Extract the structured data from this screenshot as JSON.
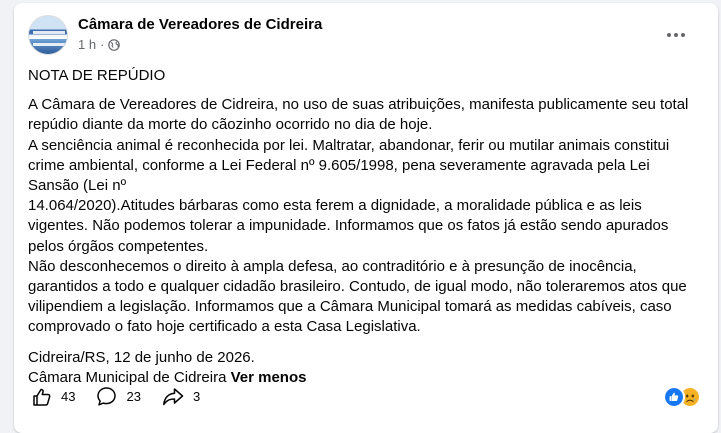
{
  "post": {
    "page_name": "Câmara de Vereadores de Cidreira",
    "time": "1 h",
    "separator": "·",
    "title": "NOTA DE REPÚDIO",
    "paragraph1": "A Câmara de Vereadores de Cidreira, no uso de suas atribuições, manifesta publicamente seu total repúdio diante da morte do cãozinho ocorrido no dia de hoje.\nA senciência animal é reconhecida por lei. Maltratar, abandonar, ferir ou mutilar animais constitui crime ambiental, conforme a Lei Federal nº 9.605/1998, pena severamente agravada pela Lei Sansão (Lei nº\n14.064/2020).Atitudes bárbaras como esta ferem a dignidade, a moralidade pública e as leis vigentes. Não podemos tolerar a impunidade. Informamos que os fatos já estão sendo apurados pelos órgãos competentes.\nNão desconhecemos o direito à ampla defesa, ao contraditório e à presunção de inocência, garantidos a todo e qualquer cidadão brasileiro. Contudo, de igual modo, não toleraremos atos que vilipendiem a legislação. Informamos que a Câmara Municipal tomará as medidas cabíveis, caso comprovado o fato hoje certificado a esta Casa Legislativa.",
    "date_line": "Cidreira/RS, 12 de junho de 2026.",
    "signature": "Câmara Municipal de Cidreira",
    "see_more": "Ver menos"
  },
  "actions": {
    "like_count": "43",
    "comment_count": "23",
    "share_count": "3"
  },
  "icons": {
    "more": "more-horizontal-icon",
    "audience": "globe-icon",
    "like": "thumbs-up-icon",
    "comment": "comment-bubble-icon",
    "share": "share-arrow-icon",
    "reaction_like": "like-reaction-icon",
    "reaction_sad": "sad-reaction-icon"
  },
  "colors": {
    "background": "#f0f2f5",
    "card": "#ffffff",
    "text": "#050505",
    "secondary": "#65676b",
    "like_blue": "#1877f2",
    "sad_yellow": "#f7b125"
  }
}
